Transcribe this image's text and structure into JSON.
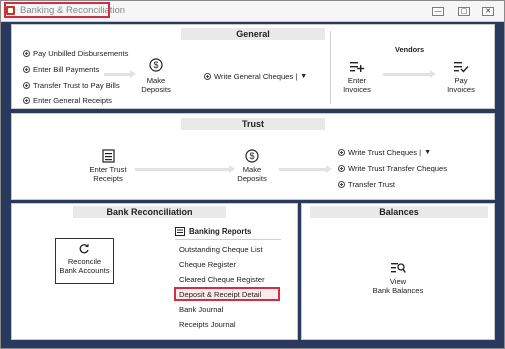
{
  "window": {
    "title": "Banking & Reconciliation",
    "minimize": "—",
    "restore": "▢",
    "close": "✕"
  },
  "general": {
    "header": "General",
    "options": [
      "Pay Unbilled Disbursements",
      "Enter Bill Payments",
      "Transfer Trust to Pay Bills",
      "Enter General Receipts"
    ],
    "make_deposits": "Make\nDeposits",
    "write_cheques": "Write General Cheques |",
    "vendors_label": "Vendors",
    "enter_invoices": "Enter\nInvoices",
    "pay_invoices": "Pay\nInvoices"
  },
  "trust": {
    "header": "Trust",
    "enter_receipts": "Enter Trust\nReceipts",
    "make_deposits": "Make\nDeposits",
    "options": [
      "Write Trust Cheques |",
      "Write Trust Transfer Cheques",
      "Transfer Trust"
    ]
  },
  "bank_reconciliation": {
    "header": "Bank Reconciliation",
    "reconcile": "Reconcile\nBank Accounts",
    "reports_title": "Banking Reports",
    "reports": [
      "Outstanding Cheque List",
      "Cheque Register",
      "Cleared Cheque Register",
      "Deposit & Receipt Detail",
      "Bank Journal",
      "Receipts Journal"
    ]
  },
  "balances": {
    "header": "Balances",
    "view": "View\nBank Balances"
  },
  "colors": {
    "highlight": "#cf2e45",
    "background": "#2a3a5e",
    "header": "#e9e9e9"
  }
}
